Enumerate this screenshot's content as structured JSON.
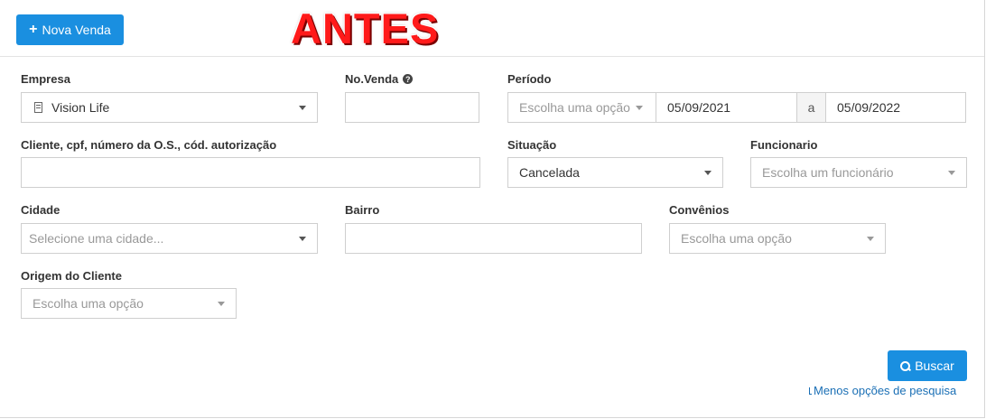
{
  "toolbar": {
    "nova_venda_label": "Nova Venda"
  },
  "overlay": {
    "antes": "ANTES"
  },
  "labels": {
    "empresa": "Empresa",
    "no_venda": "No.Venda",
    "periodo": "Período",
    "cliente": "Cliente, cpf, número da O.S., cód. autorização",
    "situacao": "Situação",
    "funcionario": "Funcionario",
    "cidade": "Cidade",
    "bairro": "Bairro",
    "convenios": "Convênios",
    "origem": "Origem do Cliente"
  },
  "fields": {
    "empresa_value": "Vision Life",
    "periodo_option": "Escolha uma opção",
    "date_from": "05/09/2021",
    "date_sep": "a",
    "date_to": "05/09/2022",
    "situacao_value": "Cancelada",
    "funcionario_placeholder": "Escolha um funcionário",
    "cidade_placeholder": "Selecione uma cidade...",
    "convenios_placeholder": "Escolha uma opção",
    "origem_placeholder": "Escolha uma opção"
  },
  "actions": {
    "buscar_label": "Buscar",
    "menos_opcoes": "Menos opções de pesquisa"
  },
  "colors": {
    "primary": "#1a8fe0",
    "antes_red": "#ff1a1a"
  }
}
